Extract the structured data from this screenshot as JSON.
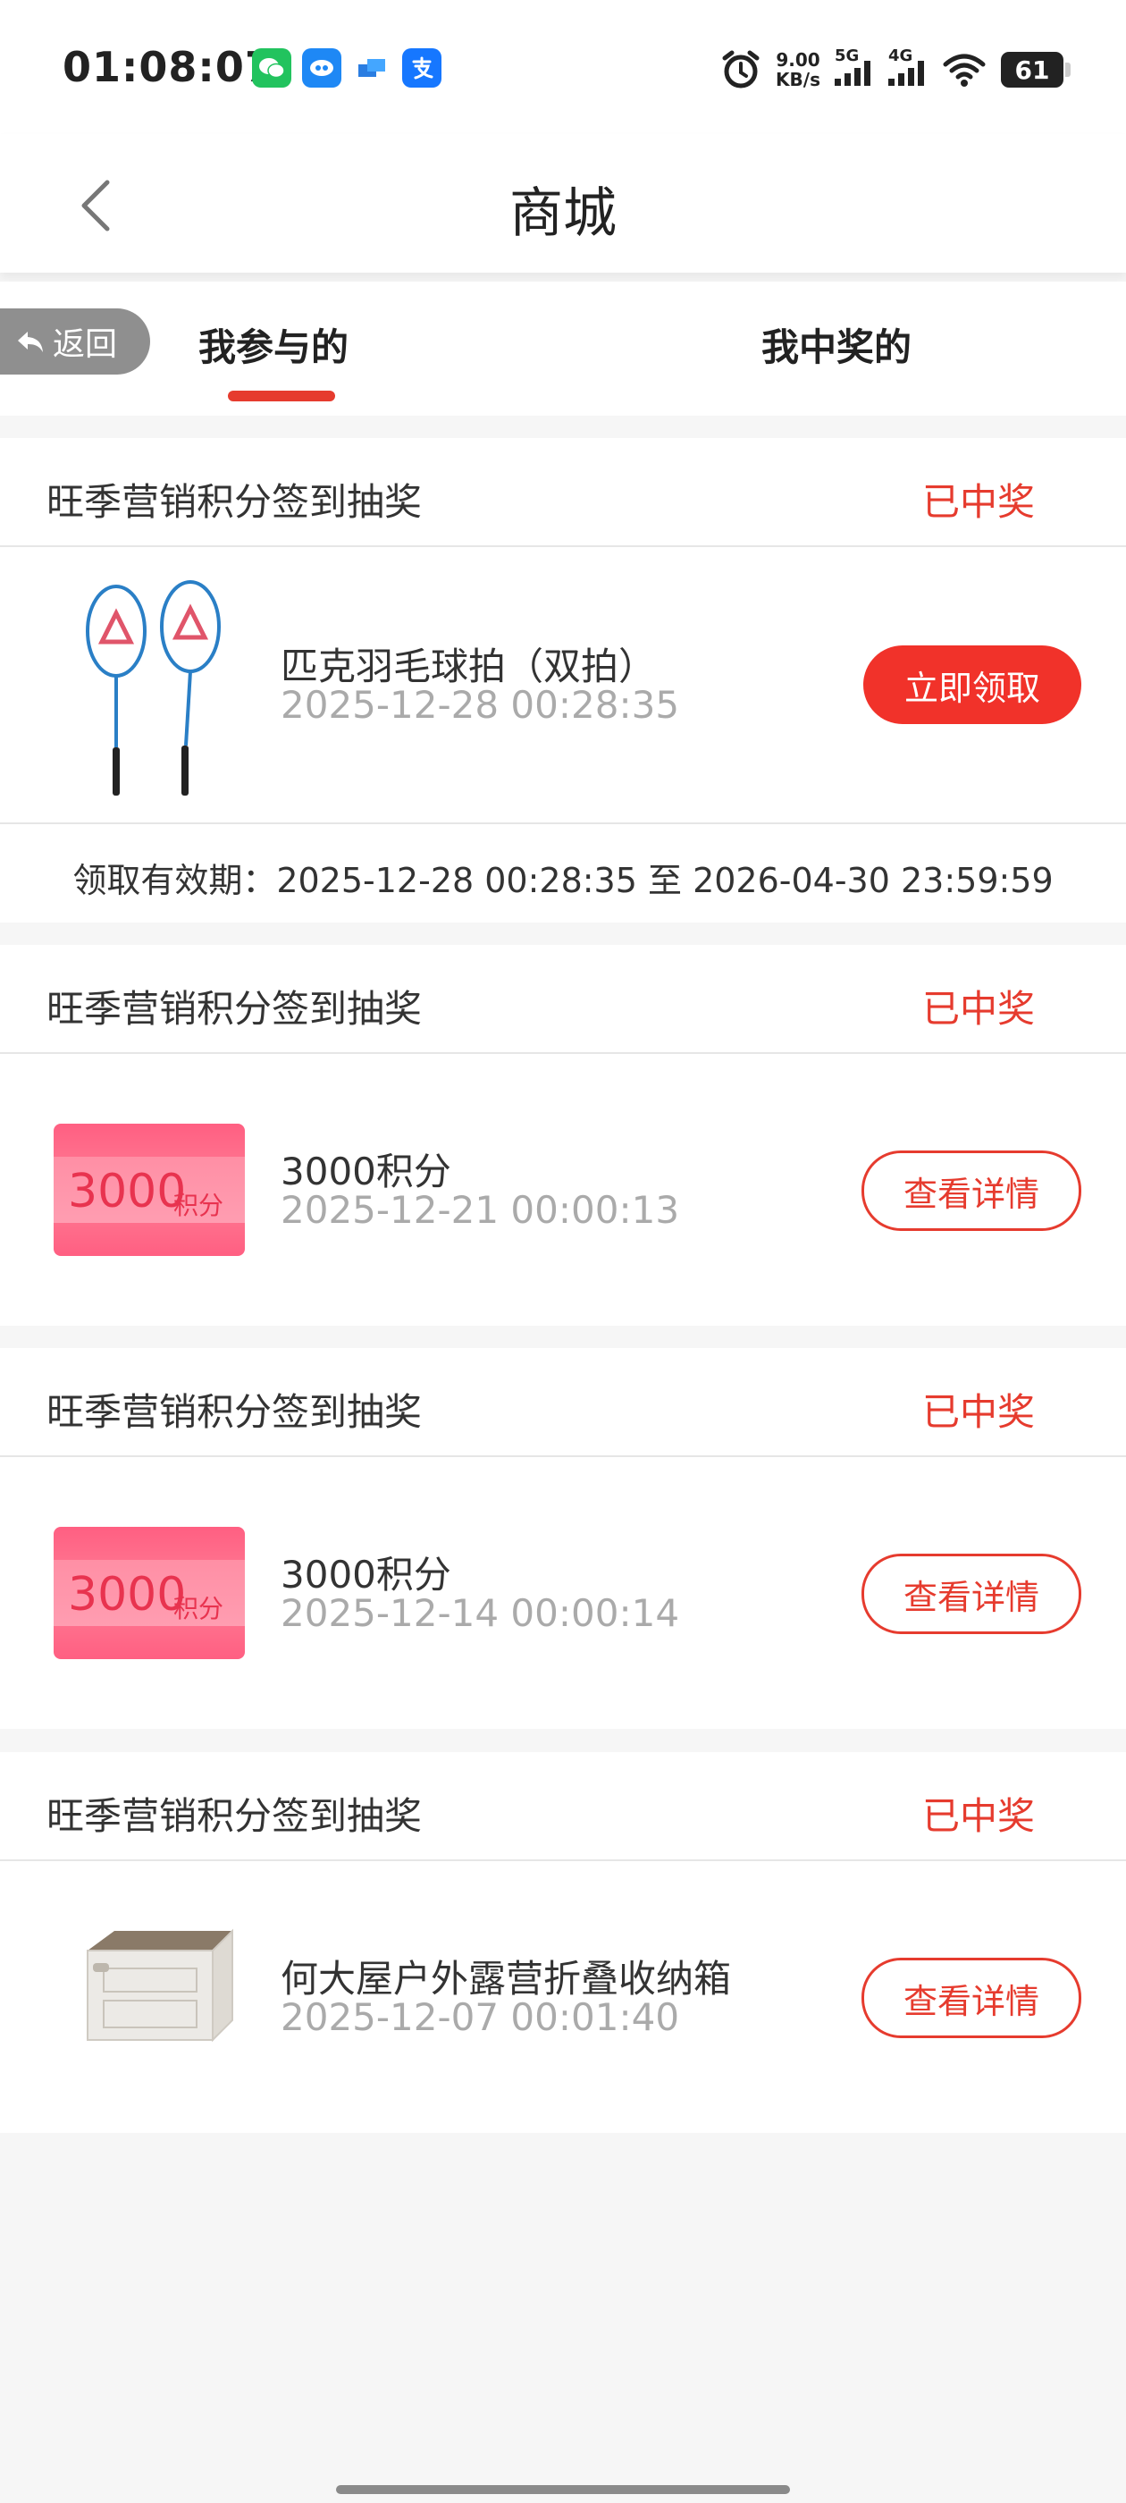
{
  "status_bar": {
    "time": "01:08:07",
    "net_speed_value": "9.00",
    "net_speed_unit": "KB/s",
    "signal1_label": "5G",
    "signal2_label": "4G",
    "battery": "61"
  },
  "nav": {
    "title": "商城"
  },
  "tabs": {
    "back_label": "返回",
    "active": "我参与的",
    "other": "我中奖的"
  },
  "records": [
    {
      "campaign": "旺季营销积分签到抽奖",
      "status": "已中奖",
      "prize_name": "匹克羽毛球拍（双拍）",
      "time": "2025-12-28 00:28:35",
      "action": "立即领取",
      "validity": "领取有效期：2025-12-28 00:28:35 至 2026-04-30 23:59:59"
    },
    {
      "campaign": "旺季营销积分签到抽奖",
      "status": "已中奖",
      "prize_name": "3000积分",
      "time": "2025-12-21 00:00:13",
      "action": "查看详情",
      "coupon_num": "3000",
      "coupon_unit": "积分"
    },
    {
      "campaign": "旺季营销积分签到抽奖",
      "status": "已中奖",
      "prize_name": "3000积分",
      "time": "2025-12-14 00:00:14",
      "action": "查看详情",
      "coupon_num": "3000",
      "coupon_unit": "积分"
    },
    {
      "campaign": "旺季营销积分签到抽奖",
      "status": "已中奖",
      "prize_name": "何大屋户外露营折叠收纳箱",
      "time": "2025-12-07 00:01:40",
      "action": "查看详情"
    }
  ],
  "colors": {
    "accent": "#e63b2e",
    "button_fill": "#f1322a"
  }
}
